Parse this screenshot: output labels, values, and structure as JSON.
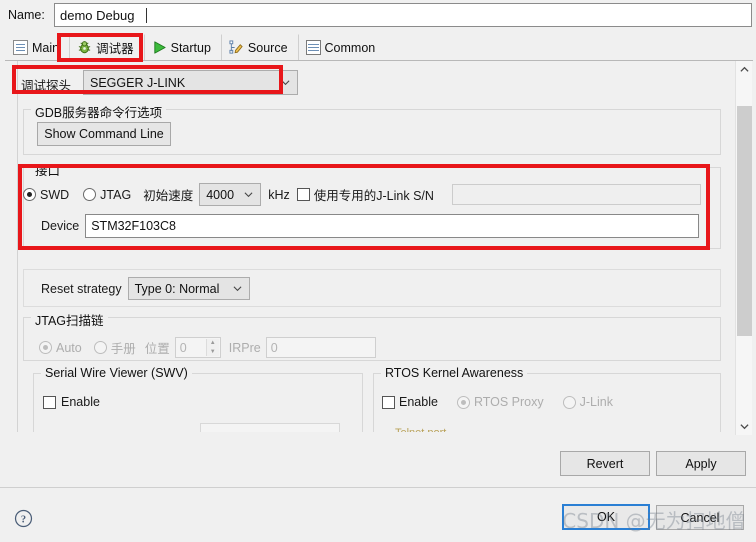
{
  "window": {
    "name_label": "Name:",
    "name_value": "demo Debug"
  },
  "tabs": [
    {
      "label": "Main",
      "icon": "document-icon",
      "active": false
    },
    {
      "label": "调试器",
      "icon": "bug-icon",
      "active": true
    },
    {
      "label": "Startup",
      "icon": "play-icon",
      "active": false
    },
    {
      "label": "Source",
      "icon": "source-tree-icon",
      "active": false
    },
    {
      "label": "Common",
      "icon": "table-icon",
      "active": false
    }
  ],
  "debugger": {
    "probe_label": "调试探头",
    "probe_value": "SEGGER J-LINK",
    "gdb_group_title": "GDB服务器命令行选项",
    "show_command_line": "Show Command Line",
    "interface": {
      "group_title": "接口",
      "swd_label": "SWD",
      "jtag_label": "JTAG",
      "swd_selected": true,
      "speed_label": "初始速度",
      "speed_value": "4000",
      "speed_unit": "kHz",
      "use_sn_label": "使用专用的J-Link S/N",
      "use_sn_checked": false,
      "sn_value": "",
      "device_label": "Device",
      "device_value": "STM32F103C8"
    },
    "reset": {
      "label": "Reset strategy",
      "value": "Type 0: Normal"
    },
    "jtag_chain": {
      "group_title": "JTAG扫描链",
      "auto_label": "Auto",
      "manual_label": "手册",
      "auto_selected": true,
      "position_label": "位置",
      "position_value": "0",
      "irpre_label": "IRPre",
      "irpre_value": "0"
    },
    "swv": {
      "group_title": "Serial Wire Viewer (SWV)",
      "enable_label": "Enable",
      "enable_checked": false
    },
    "rtos": {
      "group_title": "RTOS Kernel Awareness",
      "enable_label": "Enable",
      "enable_checked": false,
      "proxy_label": "RTOS Proxy",
      "jlink_label": "J-Link",
      "proxy_selected": true
    }
  },
  "footer": {
    "revert": "Revert",
    "apply": "Apply",
    "ok": "OK",
    "cancel": "Cancel",
    "help_icon": "question-mark-icon"
  },
  "watermark": {
    "text": "CSDN @无为扫地僧"
  },
  "colors": {
    "annotation_red": "#e8161a",
    "focus_blue": "#2a7fd4",
    "dialog_bg": "#f0f0f0"
  }
}
